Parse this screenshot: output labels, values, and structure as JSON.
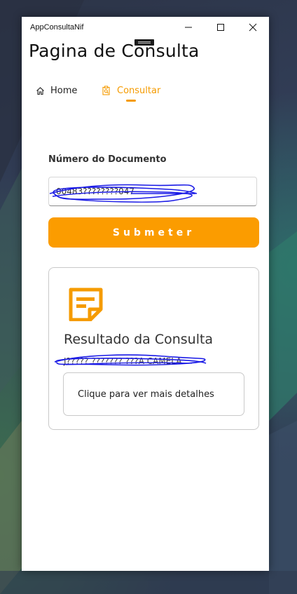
{
  "window": {
    "app_title": "AppConsultaNif"
  },
  "page": {
    "title": "Pagina de Consulta"
  },
  "nav": {
    "items": [
      {
        "label": "Home",
        "icon": "home-icon",
        "active": false
      },
      {
        "label": "Consultar",
        "icon": "search-document-icon",
        "active": true
      }
    ]
  },
  "form": {
    "field_label": "Número do Documento",
    "document_value": "00483????????047",
    "submit_label": "Submeter"
  },
  "result": {
    "title": "Resultado da Consulta",
    "name_value": "J????? ??????? ???A CAMELA",
    "details_button_label": "Clique para ver mais detalhes"
  },
  "colors": {
    "accent": "#fb9c00",
    "scribble": "#1a1ae6"
  }
}
